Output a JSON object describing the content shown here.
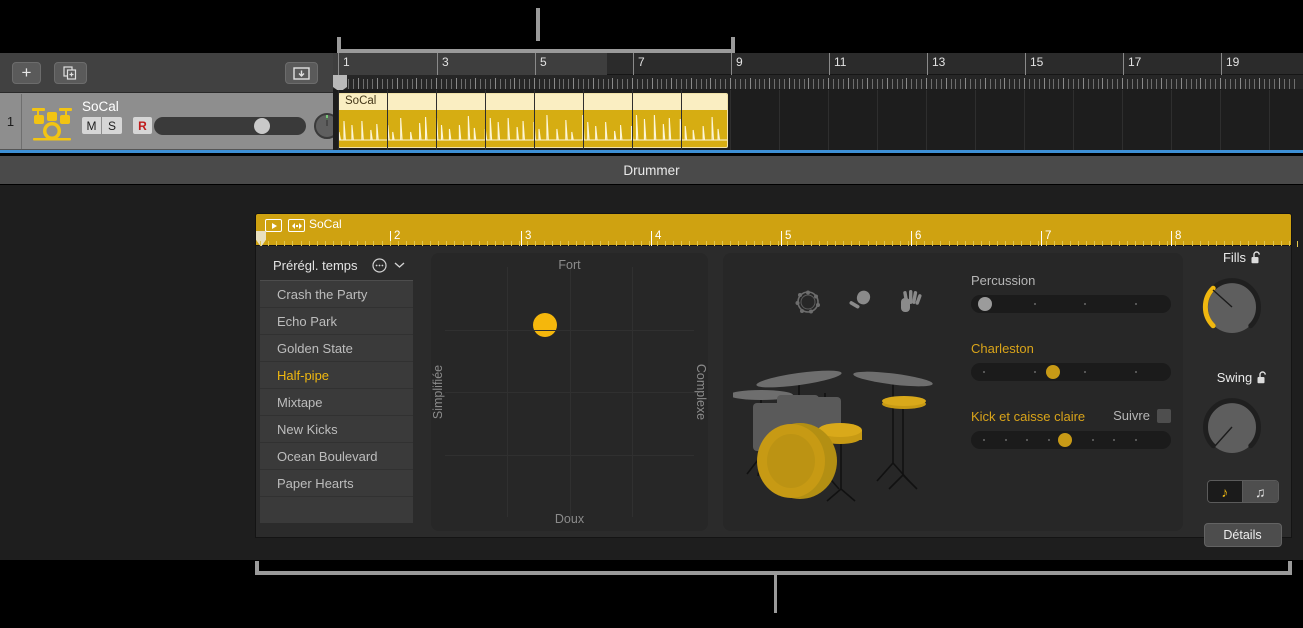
{
  "window": {
    "section_label": "Drummer"
  },
  "toolbar": {
    "add_track_label": "+",
    "duplicate_track_label": "",
    "import_label": ""
  },
  "track": {
    "number": "1",
    "name": "SoCal",
    "mute_label": "M",
    "solo_label": "S",
    "record_label": "R"
  },
  "ruler": {
    "bars": [
      "1",
      "3",
      "5",
      "7",
      "9",
      "11",
      "13",
      "15",
      "17",
      "19"
    ]
  },
  "region": {
    "name": "SoCal"
  },
  "editor": {
    "region_name": "SoCal",
    "bars": [
      "2",
      "3",
      "4",
      "5",
      "6",
      "7",
      "8"
    ]
  },
  "presets": {
    "header": "Prérégl. temps",
    "items": [
      {
        "label": "Crash the Party",
        "selected": false
      },
      {
        "label": "Echo Park",
        "selected": false
      },
      {
        "label": "Golden State",
        "selected": false
      },
      {
        "label": "Half-pipe",
        "selected": true
      },
      {
        "label": "Mixtape",
        "selected": false
      },
      {
        "label": "New Kicks",
        "selected": false
      },
      {
        "label": "Ocean Boulevard",
        "selected": false
      },
      {
        "label": "Paper Hearts",
        "selected": false
      }
    ]
  },
  "xypad": {
    "top_label": "Fort",
    "bottom_label": "Doux",
    "left_label": "Simplifiée",
    "right_label": "Complexe",
    "puck_x_pct": 40,
    "puck_y_pct": 23
  },
  "kit": {
    "percussion_icons": [
      "tambourine-icon",
      "shaker-icon",
      "clap-icon"
    ],
    "sliders": [
      {
        "name": "Percussion",
        "value_pct": 3,
        "active": false
      },
      {
        "name": "Charleston",
        "value_pct": 46,
        "active": true
      },
      {
        "name": "Kick et caisse claire",
        "value_pct": 54,
        "active": true
      }
    ],
    "follow_label": "Suivre",
    "follow_checked": false
  },
  "knobs": {
    "fills": {
      "label": "Fills",
      "locked": false,
      "value_pct": 22
    },
    "swing": {
      "label": "Swing",
      "locked": false,
      "value_pct": 8
    },
    "note_8th": "♪",
    "note_16th": "♫",
    "note_selected": "8th",
    "details_label": "Détails"
  },
  "colors": {
    "accent_gold": "#f0b810",
    "region_gold": "#d6ad12",
    "selection_blue": "#3d8fd4"
  }
}
